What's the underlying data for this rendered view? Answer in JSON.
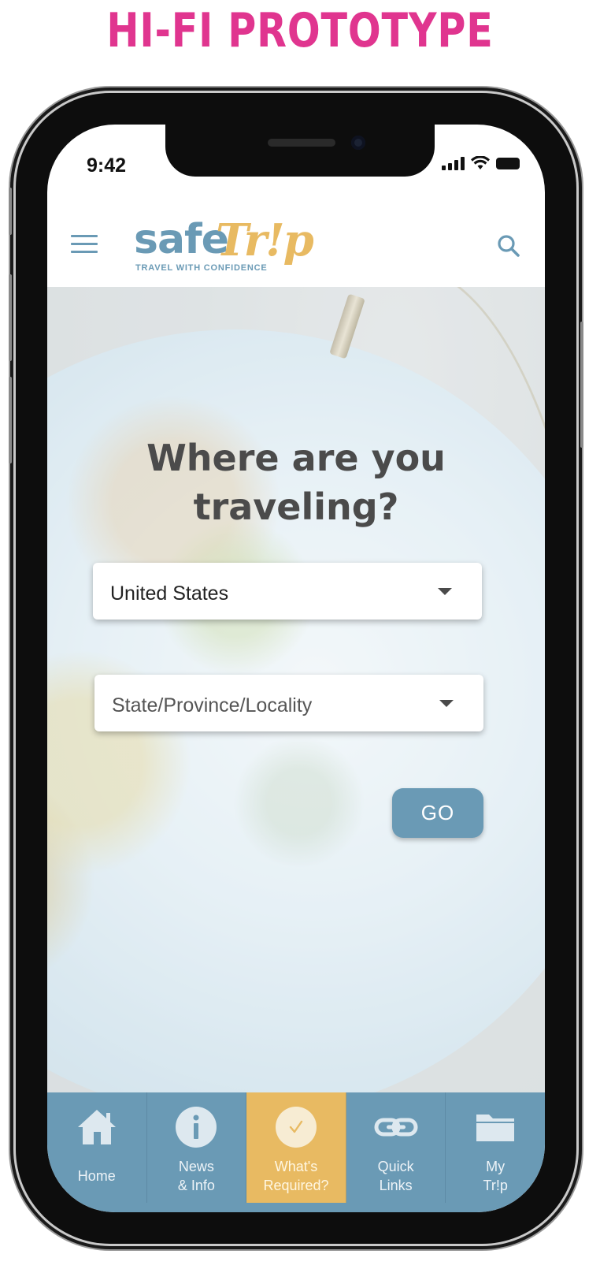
{
  "headline": "HI-FI PROTOTYPE",
  "status_bar": {
    "time": "9:42"
  },
  "header": {
    "logo_safe": "safe",
    "logo_trip": "Tr!p",
    "logo_tagline": "TRAVEL WITH CONFIDENCE",
    "menu_icon": "hamburger-menu-icon",
    "search_icon": "search-icon"
  },
  "hero": {
    "title_line1": "Where are you",
    "title_line2": "traveling?",
    "country_select": {
      "value": "United States"
    },
    "region_select": {
      "placeholder": "State/Province/Locality"
    },
    "go_label": "GO"
  },
  "bottom_nav": {
    "items": [
      {
        "line1": "Home",
        "line2": "",
        "icon": "home-icon",
        "active": false
      },
      {
        "line1": "News",
        "line2": "& Info",
        "icon": "info-icon",
        "active": false
      },
      {
        "line1": "What's",
        "line2": "Required?",
        "icon": "checkmark-icon",
        "active": true
      },
      {
        "line1": "Quick",
        "line2": "Links",
        "icon": "link-icon",
        "active": false
      },
      {
        "line1": "My",
        "line2": "Tr!p",
        "icon": "folder-icon",
        "active": false
      }
    ]
  },
  "colors": {
    "brand_blue": "#6a9ab5",
    "brand_gold": "#e8ba62",
    "headline_pink": "#e0358f"
  }
}
